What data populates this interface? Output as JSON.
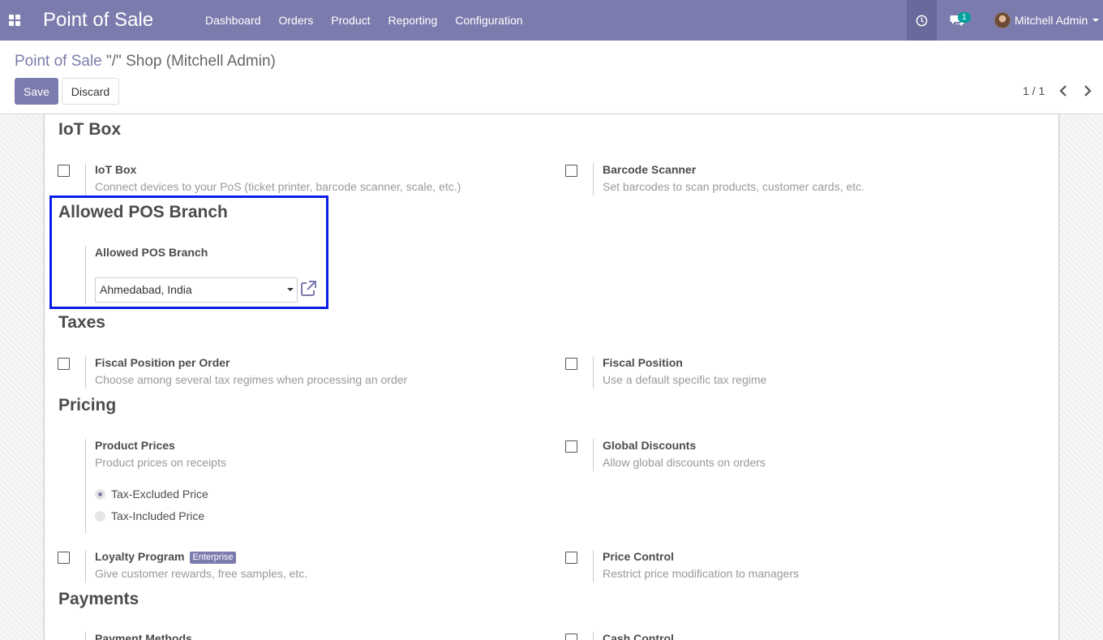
{
  "navbar": {
    "brand": "Point of Sale",
    "menu": [
      "Dashboard",
      "Orders",
      "Product",
      "Reporting",
      "Configuration"
    ],
    "messages_count": "1",
    "user_name": "Mitchell Admin"
  },
  "control_panel": {
    "breadcrumb_link": "Point of Sale",
    "breadcrumb_current": "\"/\" Shop (Mitchell Admin)",
    "save_label": "Save",
    "discard_label": "Discard",
    "pager": "1 / 1"
  },
  "sections": {
    "iot": {
      "title": "IoT Box",
      "iot_box": {
        "label": "IoT Box",
        "desc": "Connect devices to your PoS (ticket printer, barcode scanner, scale, etc.)"
      },
      "barcode": {
        "label": "Barcode Scanner",
        "desc": "Set barcodes to scan products, customer cards, etc."
      }
    },
    "branch": {
      "title": "Allowed POS Branch",
      "label": "Allowed POS Branch",
      "value": "Ahmedabad, India"
    },
    "taxes": {
      "title": "Taxes",
      "fiscal_order": {
        "label": "Fiscal Position per Order",
        "desc": "Choose among several tax regimes when processing an order"
      },
      "fiscal": {
        "label": "Fiscal Position",
        "desc": "Use a default specific tax regime"
      }
    },
    "pricing": {
      "title": "Pricing",
      "product_prices": {
        "label": "Product Prices",
        "desc": "Product prices on receipts",
        "option_excluded": "Tax-Excluded Price",
        "option_included": "Tax-Included Price"
      },
      "global_discounts": {
        "label": "Global Discounts",
        "desc": "Allow global discounts on orders"
      },
      "loyalty": {
        "label": "Loyalty Program",
        "badge": "Enterprise",
        "desc": "Give customer rewards, free samples, etc."
      },
      "price_control": {
        "label": "Price Control",
        "desc": "Restrict price modification to managers"
      }
    },
    "payments": {
      "title": "Payments",
      "methods_label": "Payment Methods",
      "cash_label": "Cash Control"
    }
  },
  "colors": {
    "accent": "#7c7bad",
    "highlight": "#0a1ee8",
    "teal": "#00a09d"
  }
}
